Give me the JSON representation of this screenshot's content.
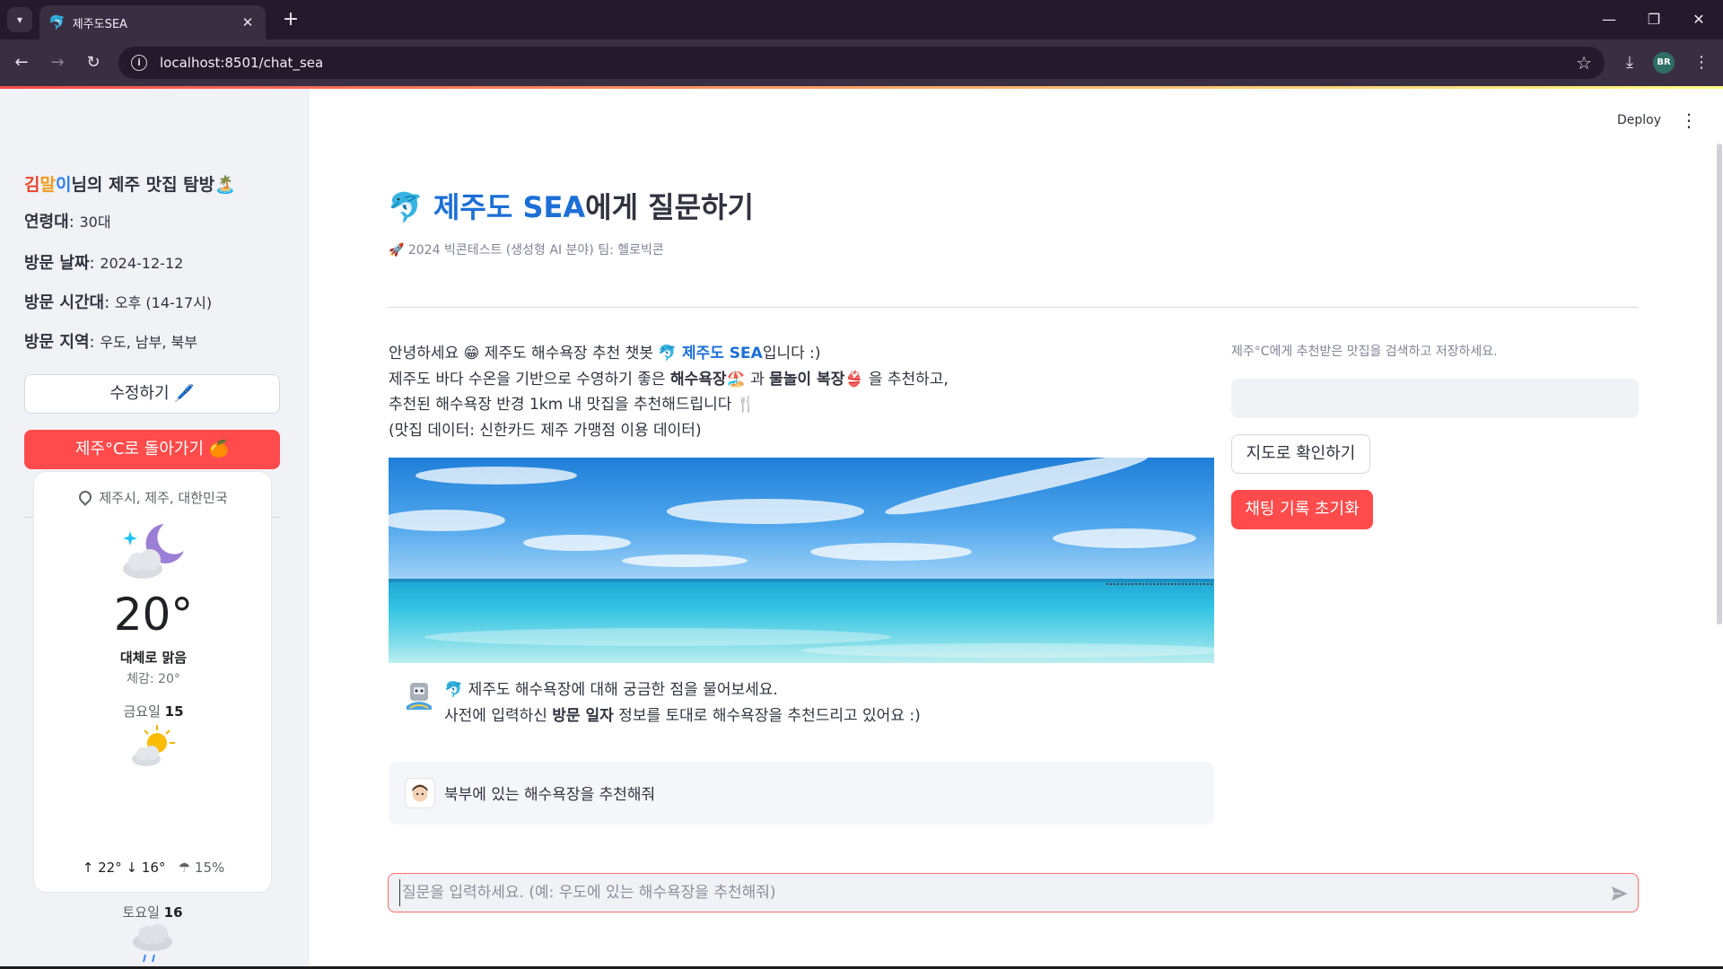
{
  "browser": {
    "tab_title": "제주도SEA",
    "tab_favicon": "🐬",
    "url": "localhost:8501/chat_sea",
    "profile_initials": "BR"
  },
  "sidebar": {
    "title_name_1": "김",
    "title_name_2": "말",
    "title_name_3": "이",
    "title_rest": "님의 제주 맛집 탐방",
    "title_emoji": "🏝️",
    "age_label": "연령대",
    "age_value": "30대",
    "date_label": "방문 날짜",
    "date_value": "2024-12-12",
    "time_label": "방문 시간대",
    "time_value": "오후 (14-17시)",
    "region_label": "방문 지역",
    "region_value": "우도, 남부, 북부",
    "edit_button": "수정하기 🖊️",
    "back_button": "제주°C로 돌아가기 🍊"
  },
  "weather": {
    "location": "제주시, 제주, 대한민국",
    "temperature": "20°",
    "condition": "대체로 맑음",
    "feels_like": "체감: 20°",
    "day1_name": "금요일",
    "day1_date": "15",
    "day1_high": "↑ 22°",
    "day1_low": "↓ 16°",
    "day1_pop": "☂ 15%",
    "day2_name": "토요일",
    "day2_date": "16"
  },
  "header": {
    "deploy": "Deploy",
    "menu": "⋮"
  },
  "main": {
    "title_emoji": "🐬",
    "title_blue": "제주도 SEA",
    "title_rest": "에게 질문하기",
    "caption": "🚀 2024 빅콘테스트 (생성형 AI 분야) 팀: 헬로빅콘",
    "intro_1a": "안녕하세요 😁 제주도 해수욕장 추천 챗봇 🐬 ",
    "intro_1b": "제주도 SEA",
    "intro_1c": "입니다 :)",
    "intro_2a": "제주도 바다 수온을 기반으로 수영하기 좋은 ",
    "intro_2b": "해수욕장",
    "intro_2c": "🏖️ 과 ",
    "intro_2d": "물놀이 복장",
    "intro_2e": "👙 을 추천하고,",
    "intro_3": "추천된 해수욕장 반경 1km 내 맛집을 추천해드립니다 🍴",
    "intro_4": "(맛집 데이터: 신한카드 제주 가맹점 이용 데이터)",
    "assistant_line1": "🐬 제주도 해수욕장에 대해 궁금한 점을 물어보세요.",
    "assistant_line2a": "사전에 입력하신 ",
    "assistant_line2b": "방문 일자",
    "assistant_line2c": " 정보를 토대로 해수욕장을 추천드리고 있어요 :)",
    "user_message": "북부에 있는 해수욕장을 추천해줘",
    "chat_placeholder": "질문을 입력하세요. (예: 우도에 있는 해수욕장을 추천해줘)"
  },
  "right_panel": {
    "caption": "제주°C에게 추천받은 맛집을 검색하고 저장하세요.",
    "search_value": "",
    "map_button": "지도로 확인하기",
    "reset_button": "채팅 기록 초기화"
  }
}
